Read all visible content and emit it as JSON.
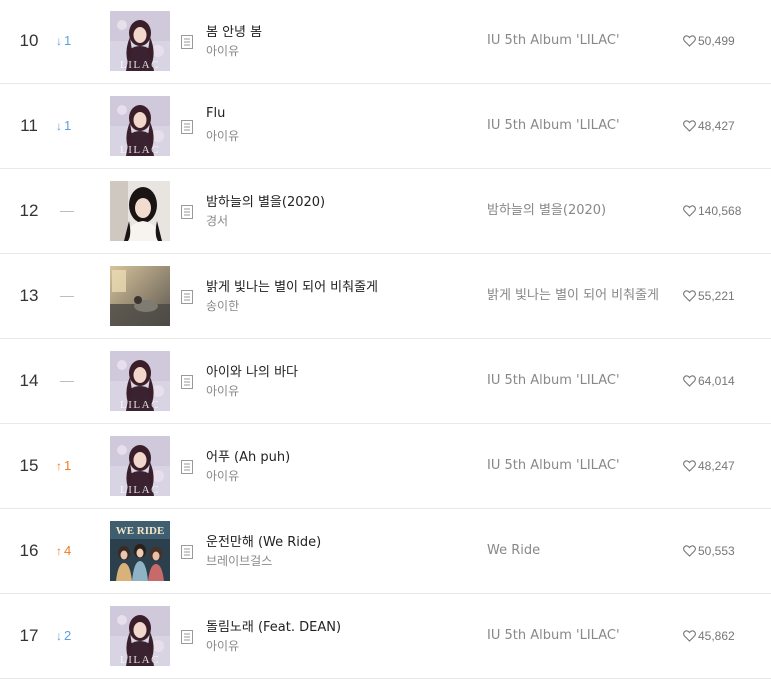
{
  "chart": {
    "rows": [
      {
        "rank": "10",
        "change_dir": "down",
        "change_num": "1",
        "title": "봄 안녕 봄",
        "artist": "아이유",
        "album": "IU 5th Album 'LILAC'",
        "likes": "50,499",
        "cover": "lilac"
      },
      {
        "rank": "11",
        "change_dir": "down",
        "change_num": "1",
        "title": "Flu",
        "artist": "아이유",
        "album": "IU 5th Album 'LILAC'",
        "likes": "48,427",
        "cover": "lilac"
      },
      {
        "rank": "12",
        "change_dir": "same",
        "change_num": "",
        "title": "밤하늘의 별을(2020)",
        "artist": "경서",
        "album": "밤하늘의 별을(2020)",
        "likes": "140,568",
        "cover": "portrait"
      },
      {
        "rank": "13",
        "change_dir": "same",
        "change_num": "",
        "title": "밝게 빛나는 별이 되어 비춰줄게",
        "artist": "송이한",
        "album": "밝게 빛나는 별이 되어 비춰줄게",
        "likes": "55,221",
        "cover": "room"
      },
      {
        "rank": "14",
        "change_dir": "same",
        "change_num": "",
        "title": "아이와 나의 바다",
        "artist": "아이유",
        "album": "IU 5th Album 'LILAC'",
        "likes": "64,014",
        "cover": "lilac"
      },
      {
        "rank": "15",
        "change_dir": "up",
        "change_num": "1",
        "title": "어푸 (Ah puh)",
        "artist": "아이유",
        "album": "IU 5th Album 'LILAC'",
        "likes": "48,247",
        "cover": "lilac"
      },
      {
        "rank": "16",
        "change_dir": "up",
        "change_num": "4",
        "title": "운전만해 (We Ride)",
        "artist": "브레이브걸스",
        "album": "We Ride",
        "likes": "50,553",
        "cover": "weride"
      },
      {
        "rank": "17",
        "change_dir": "down",
        "change_num": "2",
        "title": "돌림노래 (Feat. DEAN)",
        "artist": "아이유",
        "album": "IU 5th Album 'LILAC'",
        "likes": "45,862",
        "cover": "lilac"
      }
    ],
    "cover_text": {
      "lilac": "LILAC",
      "weride": "WE RIDE"
    },
    "colors": {
      "rank_up": "#f07a1e",
      "rank_down": "#5aa0e0",
      "no_change": "#bdbdbd"
    },
    "icons": {
      "lyrics": "lyrics-icon",
      "like": "heart-icon",
      "up": "arrow-up-icon",
      "down": "arrow-down-icon"
    }
  }
}
